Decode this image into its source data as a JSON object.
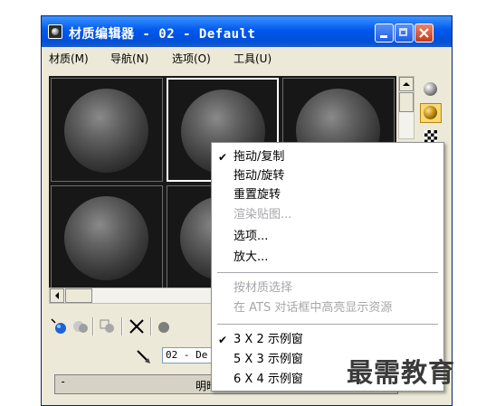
{
  "window": {
    "title": "材质编辑器 - 02 - Default"
  },
  "menubar": {
    "items": [
      "材质(M)",
      "导航(N)",
      "选项(O)",
      "工具(U)"
    ]
  },
  "sidebar_buttons": [
    "sample-type-icon",
    "backlight-icon",
    "background-checker-icon"
  ],
  "toolbar": {
    "icons": [
      "get-material-icon",
      "put-to-scene-icon",
      "assign-to-selection-icon",
      "reset-map-icon",
      "delete-icon",
      "make-copy-icon"
    ]
  },
  "name_field": {
    "value": "02 - De"
  },
  "rollout": {
    "toggle": "-",
    "title": "明暗器基本参数"
  },
  "context_menu": {
    "items": [
      {
        "label": "拖动/复制",
        "checked": true,
        "disabled": false
      },
      {
        "label": "拖动/旋转",
        "checked": false,
        "disabled": false
      },
      {
        "label": "重置旋转",
        "checked": false,
        "disabled": false
      },
      {
        "label": "渲染贴图...",
        "checked": false,
        "disabled": true
      },
      {
        "label": "选项...",
        "checked": false,
        "disabled": false
      },
      {
        "label": "放大...",
        "checked": false,
        "disabled": false
      },
      {
        "label": "按材质选择",
        "checked": false,
        "disabled": true
      },
      {
        "label": "在 ATS 对话框中高亮显示资源",
        "checked": false,
        "disabled": true
      },
      {
        "label": "3 X 2 示例窗",
        "checked": true,
        "disabled": false
      },
      {
        "label": "5 X 3 示例窗",
        "checked": false,
        "disabled": false
      },
      {
        "label": "6 X 4 示例窗",
        "checked": false,
        "disabled": false
      }
    ]
  },
  "watermark": "最需教育",
  "colors": {
    "titlebar": "#0058ee",
    "window_bg": "#ece9d8",
    "disabled_text": "#a7a6aa"
  }
}
